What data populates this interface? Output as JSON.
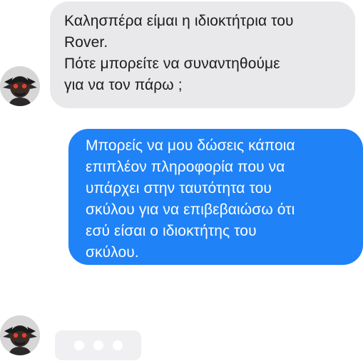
{
  "conversation": {
    "messages": [
      {
        "direction": "incoming",
        "text": "Καλησπέρα είμαι η ιδιοκτήτρια του\nRover.\nΠότε μπορείτε να συναντηθούμε\nγια να τον πάρω ;"
      },
      {
        "direction": "outgoing",
        "text": "Μπορείς να μου δώσεις κάποια\nεπιπλέον πληροφορία που να\nυπάρχει στην ταυτότητα του\nσκύλου για να επιβεβαιώσω ότι\nεσύ είσαι ο ιδιοκτήτης του\nσκύλου."
      }
    ],
    "typing_indicator": {
      "dots": 3
    }
  },
  "colors": {
    "incoming_bubble": "#e9e9eb",
    "outgoing_bubble": "#1f82f7",
    "typing_bubble": "#f0f0f2"
  },
  "icons": {
    "avatar": "masked-character-avatar-icon"
  }
}
